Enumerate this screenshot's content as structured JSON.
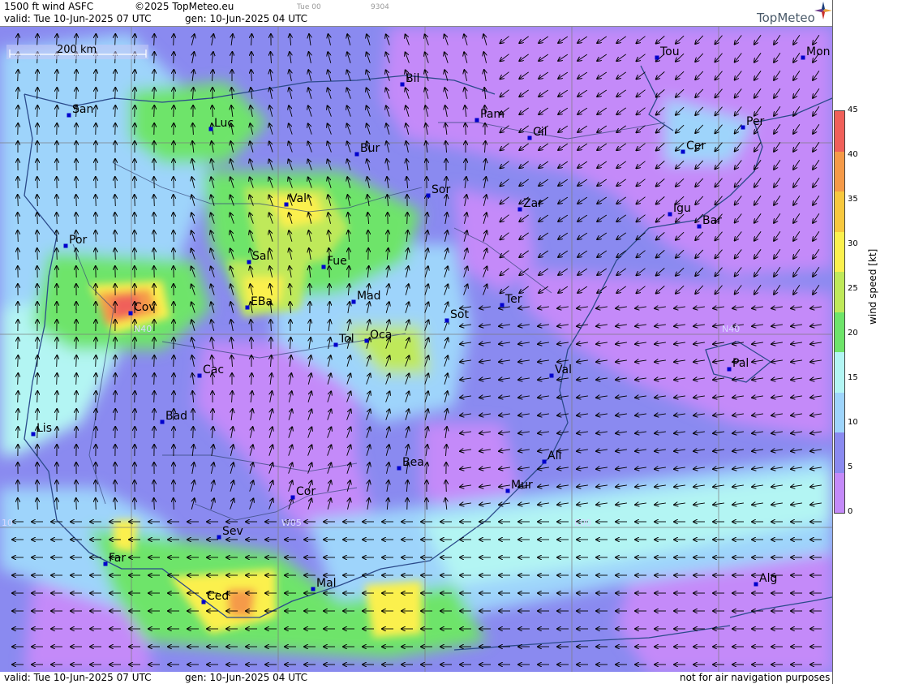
{
  "header": {
    "title": "1500 ft wind ASFC",
    "copyright": "©2025 TopMeteo.eu",
    "run_small": "Tue 00",
    "code_small": "9304",
    "valid": "valid:  Tue  10-Jun-2025  07 UTC",
    "gen": "gen: 10-Jun-2025 04 UTC",
    "brand": "TopMeteo"
  },
  "footer": {
    "valid": "valid:  Tue  10-Jun-2025  07 UTC",
    "gen": "gen: 10-Jun-2025 04 UTC",
    "disclaimer": "not for air navigation purposes"
  },
  "map": {
    "scale_label": "200 km",
    "grid_labels": {
      "n40_west": "N40",
      "n40_east": "N40",
      "w05": "W05",
      "e00": "E00",
      "w10": "10"
    },
    "cities": [
      {
        "name": "San"
      },
      {
        "name": "Luc"
      },
      {
        "name": "Bil"
      },
      {
        "name": "Tou"
      },
      {
        "name": "Mon"
      },
      {
        "name": "Pam"
      },
      {
        "name": "Cil"
      },
      {
        "name": "Per"
      },
      {
        "name": "Bur"
      },
      {
        "name": "Cer"
      },
      {
        "name": "Val"
      },
      {
        "name": "Sor"
      },
      {
        "name": "Zar"
      },
      {
        "name": "Igu"
      },
      {
        "name": "Bar"
      },
      {
        "name": "Por"
      },
      {
        "name": "Sal"
      },
      {
        "name": "Fue"
      },
      {
        "name": "Mad"
      },
      {
        "name": "Cov"
      },
      {
        "name": "EBa"
      },
      {
        "name": "Sot"
      },
      {
        "name": "Ter"
      },
      {
        "name": "Tol"
      },
      {
        "name": "Oca"
      },
      {
        "name": "Cac"
      },
      {
        "name": "Val"
      },
      {
        "name": "Pal"
      },
      {
        "name": "Bad"
      },
      {
        "name": "Lis"
      },
      {
        "name": "Ali"
      },
      {
        "name": "Bea"
      },
      {
        "name": "Mur"
      },
      {
        "name": "Cor"
      },
      {
        "name": "Sev"
      },
      {
        "name": "Far"
      },
      {
        "name": "Mal"
      },
      {
        "name": "Alg"
      },
      {
        "name": "Ced"
      }
    ]
  },
  "legend": {
    "unit_label": "wind speed [kt]",
    "ticks": [
      "45",
      "40",
      "35",
      "30",
      "25",
      "20",
      "15",
      "10",
      "5",
      "0"
    ],
    "colors": [
      "#f0605a",
      "#f59a48",
      "#f7c83e",
      "#fbf04e",
      "#bfe95a",
      "#6ee46a",
      "#b3f5f3",
      "#9ed4fb",
      "#8a8af0",
      "#c48af9"
    ]
  },
  "colors": {
    "calm": "#c48af9",
    "light": "#8a8af0",
    "moderate": "#9ed4fb",
    "fresh": "#b3f5f3",
    "strong": "#6ee46a",
    "stronger": "#bfe95a",
    "high": "#fbf04e",
    "very_high": "#f59a48",
    "extreme": "#f0605a"
  }
}
